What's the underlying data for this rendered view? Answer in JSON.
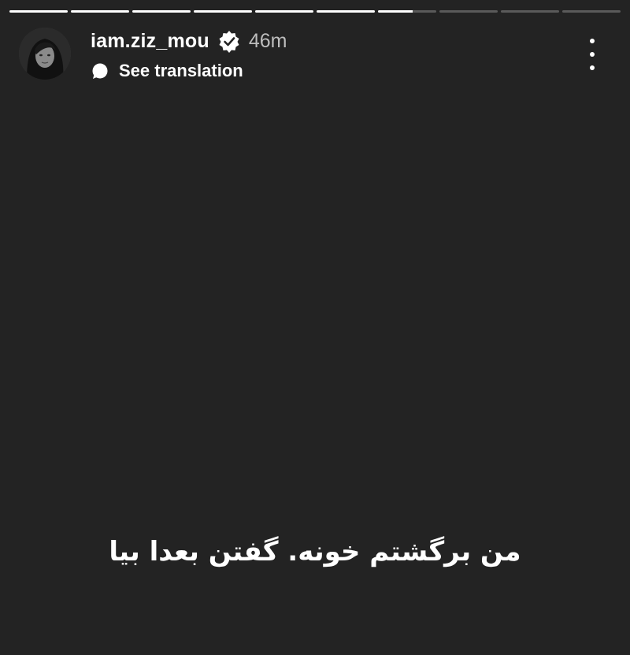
{
  "story": {
    "segments_total": 10,
    "segments_completed": 6,
    "current_segment_progress": 0.6,
    "colors": {
      "background": "#232323",
      "progress_active": "#ffffff",
      "progress_inactive": "#5a5a5a",
      "time_text": "#bdbdbd"
    }
  },
  "header": {
    "avatar_icon": "profile-avatar",
    "username": "iam.ziz_mou",
    "verified_icon": "verified-badge-icon",
    "time_ago": "46m",
    "translate_icon": "speech-bubble-icon",
    "translate_label": "See translation",
    "more_icon": "vertical-ellipsis-icon"
  },
  "content": {
    "caption": "من برگشتم خونه. گفتن بعدا بیا"
  }
}
